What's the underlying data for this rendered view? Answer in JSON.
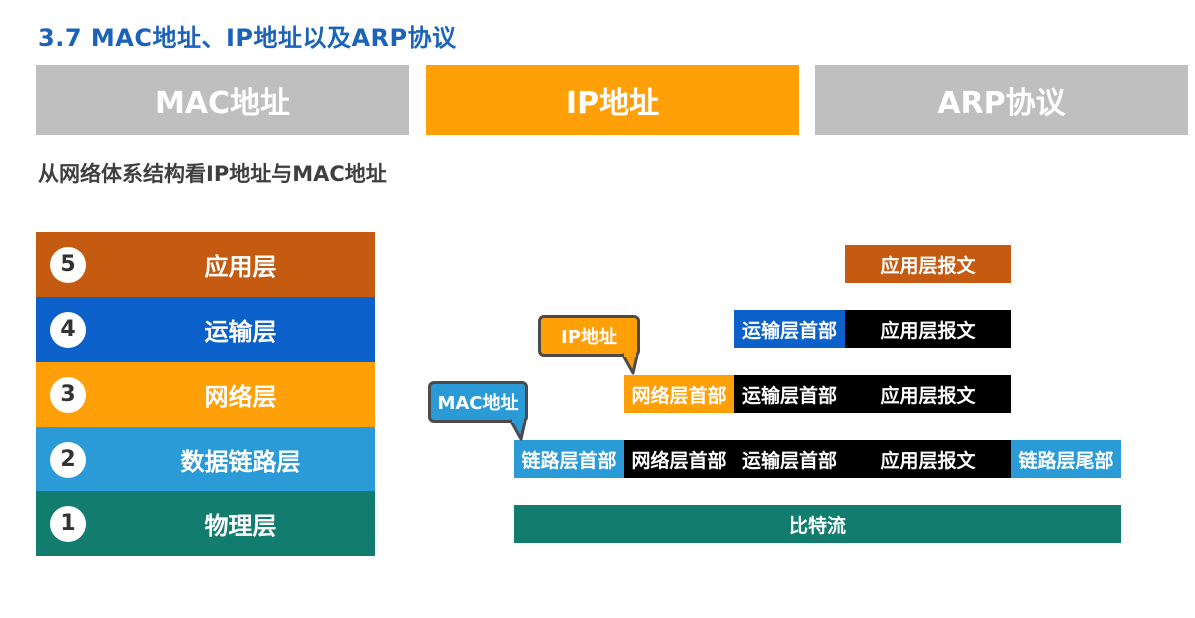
{
  "title": "3.7 MAC地址、IP地址以及ARP协议",
  "tabs": [
    {
      "label": "MAC地址",
      "color": "#bfbfbf",
      "active": false
    },
    {
      "label": "IP地址",
      "color": "#ffa008",
      "active": true
    },
    {
      "label": "ARP协议",
      "color": "#bfbfbf",
      "active": false
    }
  ],
  "subtitle": "从网络体系结构看IP地址与MAC地址",
  "layers": [
    {
      "num": "5",
      "label": "应用层",
      "color": "#c55a11"
    },
    {
      "num": "4",
      "label": "运输层",
      "color": "#0b61c9"
    },
    {
      "num": "3",
      "label": "网络层",
      "color": "#ffa008"
    },
    {
      "num": "2",
      "label": "数据链路层",
      "color": "#2a9bd6"
    },
    {
      "num": "1",
      "label": "物理层",
      "color": "#127d6e"
    }
  ],
  "pdu": {
    "app_message": "应用层报文",
    "transport_header": "运输层首部",
    "network_header": "网络层首部",
    "link_header": "链路层首部",
    "link_trailer": "链路层尾部",
    "bitstream": "比特流"
  },
  "callouts": {
    "ip": "IP地址",
    "mac": "MAC地址"
  },
  "colors": {
    "black_block": "#000000",
    "app_orange": "#c55a11",
    "transport_blue": "#0b61c9",
    "network_orange": "#ffa008",
    "link_blue": "#2a9bd6",
    "physical_teal": "#127d6e"
  }
}
